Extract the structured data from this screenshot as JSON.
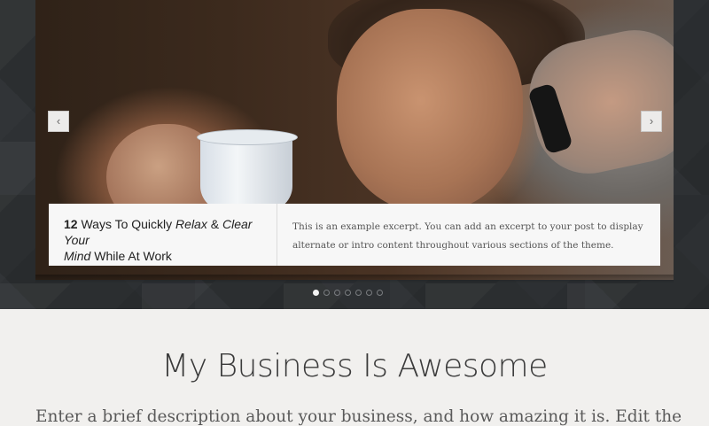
{
  "slider": {
    "prev_icon": "‹",
    "next_icon": "›",
    "caption": {
      "title_number": "12",
      "title_part1": " Ways To Quickly ",
      "title_relax": "Relax",
      "title_amp": " & ",
      "title_clear": "Clear Your",
      "title_mind": "Mind",
      "title_rest": " While At Work",
      "excerpt": "This is an example excerpt. You can add an excerpt to your post to display alternate or intro content throughout various sections of the theme."
    },
    "dots": [
      {
        "active": true
      },
      {
        "active": false
      },
      {
        "active": false
      },
      {
        "active": false
      },
      {
        "active": false
      },
      {
        "active": false
      },
      {
        "active": false
      }
    ]
  },
  "intro": {
    "heading": "My Business Is Awesome",
    "description": "Enter a brief description about your business, and how amazing it is. Edit the"
  },
  "colors": {
    "hero_background": "#2d3033",
    "page_background": "#f1f0ee",
    "caption_background": "#f7f7f7"
  }
}
